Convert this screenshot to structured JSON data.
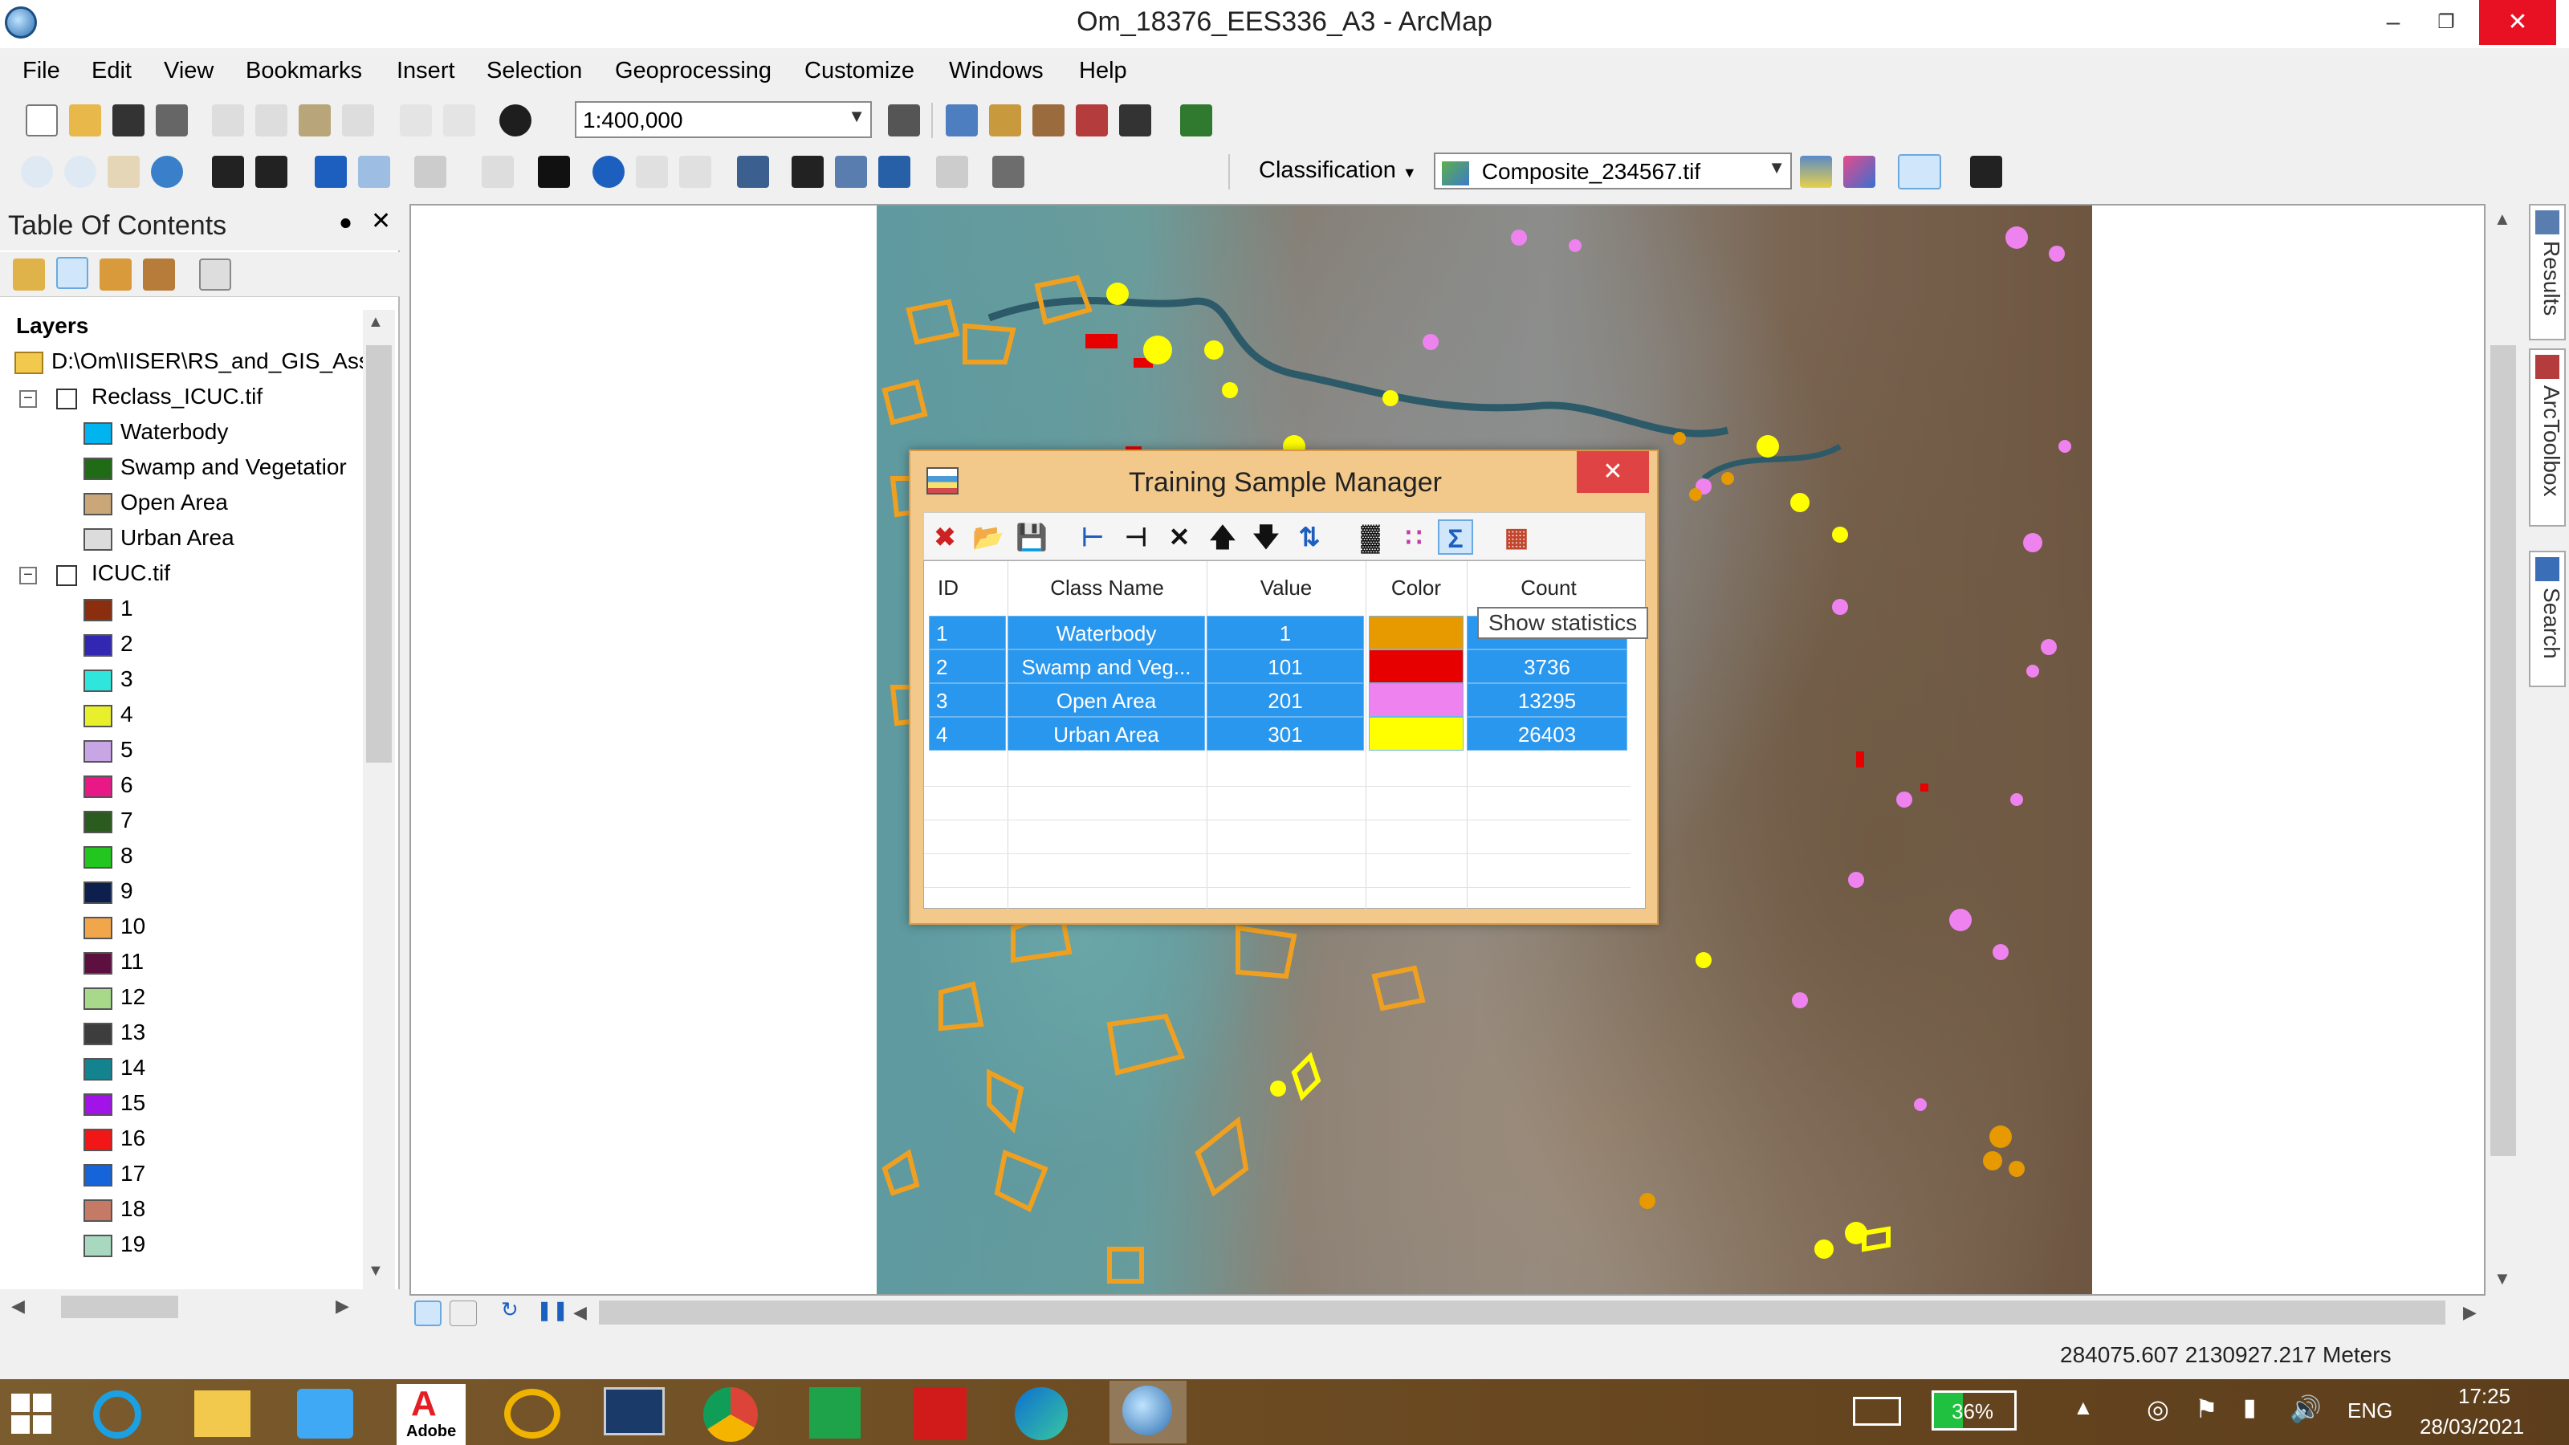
{
  "window": {
    "title": "Om_18376_EES336_A3 - ArcMap"
  },
  "menu": [
    "File",
    "Edit",
    "View",
    "Bookmarks",
    "Insert",
    "Selection",
    "Geoprocessing",
    "Customize",
    "Windows",
    "Help"
  ],
  "toolbar": {
    "scale": "1:400,000",
    "classification_label": "Classification",
    "layer_combo": "Composite_234567.tif"
  },
  "toc": {
    "title": "Table Of Contents",
    "layers_header": "Layers",
    "path": "D:\\Om\\IISER\\RS_and_GIS_Ass",
    "reclass": {
      "name": "Reclass_ICUC.tif",
      "classes": [
        {
          "label": "Waterbody",
          "color": "#00b4f0"
        },
        {
          "label": "Swamp and Vegetatior",
          "color": "#1f6b16"
        },
        {
          "label": "Open Area",
          "color": "#c9a778"
        },
        {
          "label": "Urban Area",
          "color": "#dcdcdc"
        }
      ]
    },
    "icuc": {
      "name": "ICUC.tif",
      "classes": [
        {
          "label": "1",
          "color": "#8b2e0e"
        },
        {
          "label": "2",
          "color": "#3227b3"
        },
        {
          "label": "3",
          "color": "#2ee6dc"
        },
        {
          "label": "4",
          "color": "#e8f02b"
        },
        {
          "label": "5",
          "color": "#c8a6e6"
        },
        {
          "label": "6",
          "color": "#e81886"
        },
        {
          "label": "7",
          "color": "#2b5b1f"
        },
        {
          "label": "8",
          "color": "#22c61e"
        },
        {
          "label": "9",
          "color": "#0d1f4d"
        },
        {
          "label": "10",
          "color": "#f2a64b"
        },
        {
          "label": "11",
          "color": "#5d0f3f"
        },
        {
          "label": "12",
          "color": "#a8d88a"
        },
        {
          "label": "13",
          "color": "#3d3d3d"
        },
        {
          "label": "14",
          "color": "#13848f"
        },
        {
          "label": "15",
          "color": "#a113e6"
        },
        {
          "label": "16",
          "color": "#f21616"
        },
        {
          "label": "17",
          "color": "#1664d9"
        },
        {
          "label": "18",
          "color": "#c47a64"
        },
        {
          "label": "19",
          "color": "#a8d8c0"
        }
      ]
    }
  },
  "dialog": {
    "title": "Training Sample Manager",
    "columns": [
      "ID",
      "Class Name",
      "Value",
      "Color",
      "Count"
    ],
    "rows": [
      {
        "id": "1",
        "name": "Waterbody",
        "value": "1",
        "color": "#e69a00",
        "count": ""
      },
      {
        "id": "2",
        "name": "Swamp and Veg...",
        "value": "101",
        "color": "#e60000",
        "count": "3736"
      },
      {
        "id": "3",
        "name": "Open Area",
        "value": "201",
        "color": "#ee82ee",
        "count": "13295"
      },
      {
        "id": "4",
        "name": "Urban Area",
        "value": "301",
        "color": "#ffff00",
        "count": "26403"
      }
    ],
    "tooltip": "Show statistics"
  },
  "statusbar": {
    "coordinates": "284075.607  2130927.217 Meters"
  },
  "dock": [
    "Results",
    "ArcToolbox",
    "Search"
  ],
  "taskbar": {
    "battery": "36%",
    "language": "ENG",
    "time": "17:25",
    "date": "28/03/2021",
    "adobe_label": "Adobe"
  }
}
